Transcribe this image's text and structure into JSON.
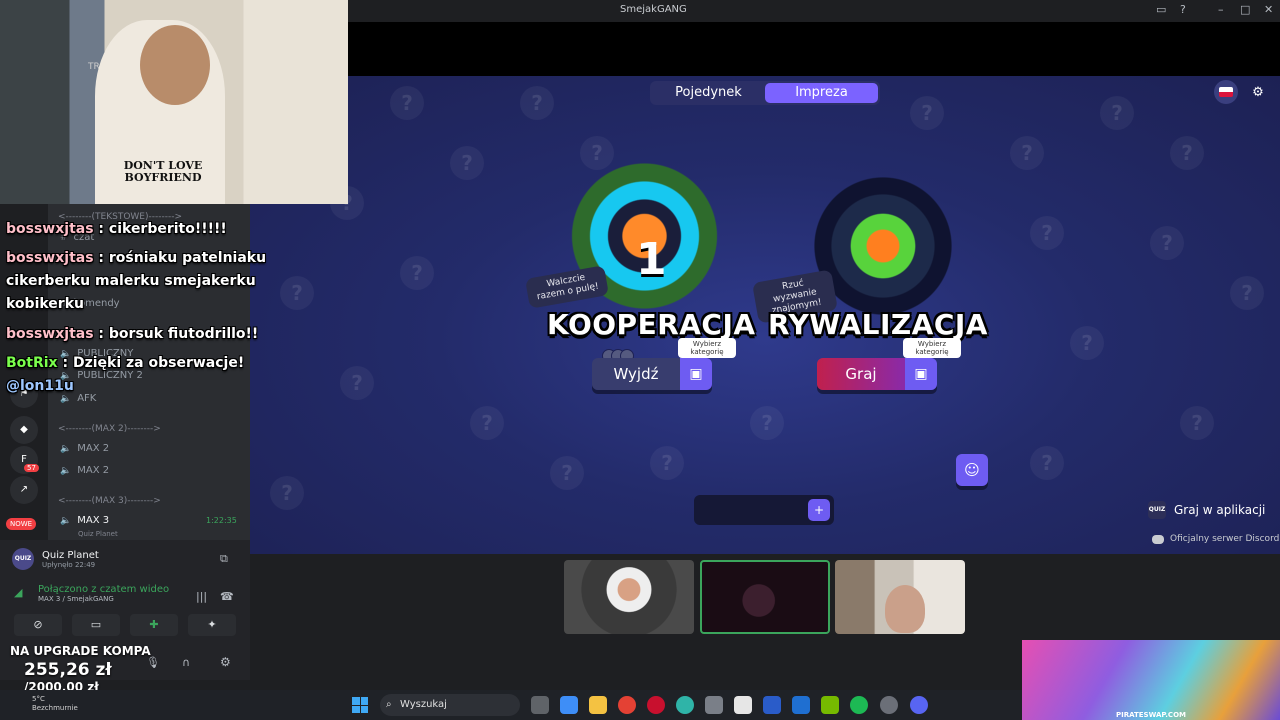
{
  "window": {
    "title": "SmejakGANG",
    "controls": [
      "–",
      "□",
      "✕"
    ]
  },
  "game": {
    "tabs": [
      {
        "label": "Pojedynek",
        "active": false
      },
      {
        "label": "Impreza",
        "active": true
      }
    ],
    "coop": {
      "number": "1",
      "speech": "Walczcie razem o pulę!",
      "title": "KOOPERACJA",
      "tag": "Wybierz kategorię",
      "button": "Wyjdź"
    },
    "rival": {
      "speech": "Rzuć wyzwanie znajomym!",
      "title": "RYWALIZACJA",
      "tag": "Wybierz kategorię",
      "button": "Graj"
    },
    "app_link": {
      "logo": "QUIZ",
      "label": "Graj w aplikacji"
    },
    "discord_link": "Oficjalny serwer Discord"
  },
  "sidebar": {
    "categories": [
      {
        "label": "<--------(TEKSTOWE)-------->"
      },
      {
        "label": "<--------(MAX 2)-------->"
      },
      {
        "label": "<--------(MAX 3)-------->"
      }
    ],
    "channels": [
      {
        "label": "czat"
      },
      {
        "label": "komendy"
      },
      {
        "label": "PUBLICZNY"
      },
      {
        "label": "PUBLICZNY 2"
      },
      {
        "label": "AFK"
      },
      {
        "label": "MAX 2"
      },
      {
        "label": "MAX 2"
      },
      {
        "label": "MAX 3",
        "timer": "1:22:35",
        "activity": "Quiz Planet"
      }
    ],
    "rail_badges": {
      "new": "NOWE",
      "count": "57"
    }
  },
  "user_panel": {
    "activity_logo": "QUIZ",
    "activity_name": "Quiz Planet",
    "activity_elapsed": "Upłynęło 22:49",
    "voice_status": "Połączono z czatem wideo",
    "voice_channel": "MAX 3 / SmejakGANG"
  },
  "webcam": {
    "shirt_text": "DON'T LOVE BOYFRIEND",
    "chair_brand": "TREME"
  },
  "chat": [
    {
      "user": "bosswxjtas",
      "text": "cikerberito!!!!!"
    },
    {
      "user": "bosswxjtas",
      "text": "rośniaku patelniaku cikerberku malerku smejakerku kobikerku"
    },
    {
      "user": "bosswxjtas",
      "text": "borsuk fiutodrillo!!"
    },
    {
      "user": "BotRix",
      "text": "Dzięki za obserwacje!",
      "mention": "@lon11u"
    }
  ],
  "donation": {
    "label": "NA UPGRADE KOMPA",
    "amount": "255,26 zł",
    "goal": "/2000,00 zł"
  },
  "taskbar": {
    "weather_temp": "5°C",
    "weather_text": "Bezchmurnie",
    "search_placeholder": "Wyszukaj"
  },
  "ad": {
    "caption": "PIRATESWAP.COM"
  }
}
